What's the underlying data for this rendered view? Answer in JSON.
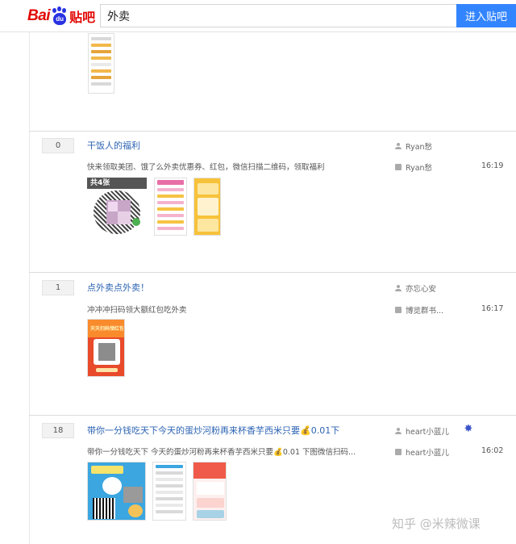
{
  "header": {
    "logo_text": "Bai",
    "logo_paw_text": "du",
    "logo_suffix": "贴吧",
    "search_value": "外卖",
    "enter_button": "进入贴吧"
  },
  "threads": [
    {
      "reply_count": "0",
      "title": "干饭人的福利",
      "preview": "快来领取美团、饿了么外卖优惠券、红包，微信扫描二维码，领取福利",
      "author": "Ryan愁",
      "last_replier": "Ryan愁",
      "time": "16:19",
      "thumb_overlay": "共4张"
    },
    {
      "reply_count": "1",
      "title": "点外卖点外卖！",
      "preview": "冲冲冲扫码领大额红包吃外卖",
      "author": "亦忘心安",
      "last_replier": "博览群书...",
      "time": "16:17",
      "thumb_overlay": "天天扫码领红包"
    },
    {
      "reply_count": "18",
      "title": "带你一分钱吃天下今天的蛋炒河粉再来杯香芋西米只要💰0.01下",
      "preview": "带你一分钱吃天下 今天的蛋炒河粉再来杯香芋西米只要💰0.01 下图微信扫码...",
      "author": "heart小蓝儿",
      "last_replier": "heart小蓝儿",
      "time": "16:02"
    }
  ],
  "icons": {
    "author": "user-icon",
    "reply": "reply-icon",
    "badge": "star-badge-icon"
  },
  "watermark": "知乎 @米辣微课",
  "colors": {
    "title_link": "#2d64b3",
    "search_button": "#3385ff",
    "logo_red": "#e10602",
    "logo_blue": "#2932e1"
  }
}
